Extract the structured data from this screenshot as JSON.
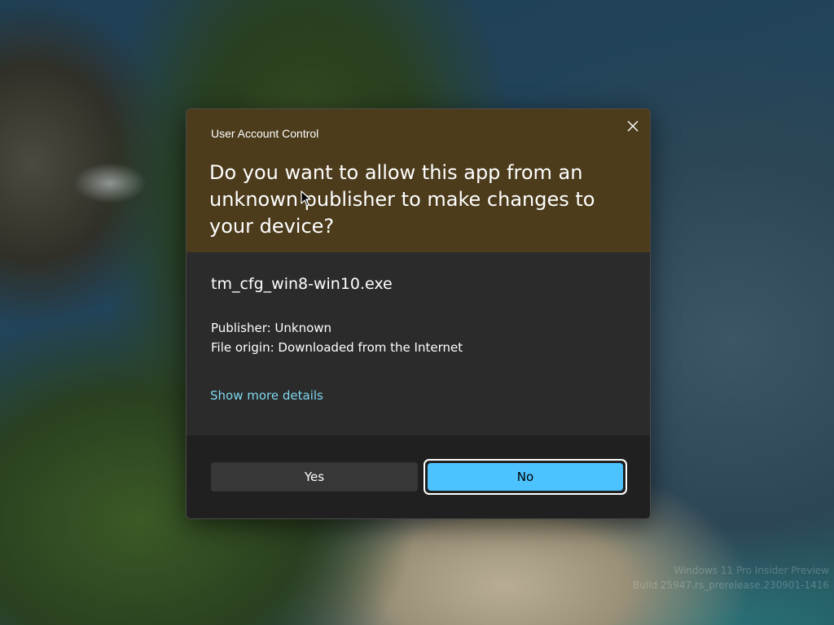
{
  "dialog": {
    "title": "User Account Control",
    "question": "Do you want to allow this app from an unknown publisher to make changes to your device?",
    "app_name": "tm_cfg_win8-win10.exe",
    "publisher": "Publisher: Unknown",
    "file_origin": "File origin: Downloaded from the Internet",
    "details_link": "Show more details",
    "yes_label": "Yes",
    "no_label": "No",
    "close_icon": "close-icon",
    "header_color": "#4c3c1c",
    "accent_color": "#4cc2ff",
    "link_color": "#7fd6ee"
  },
  "desktop": {
    "watermark_line1": "Windows 11 Pro Insider Preview",
    "watermark_line2": "Build 25947.rs_prerelease.230901-1416"
  }
}
